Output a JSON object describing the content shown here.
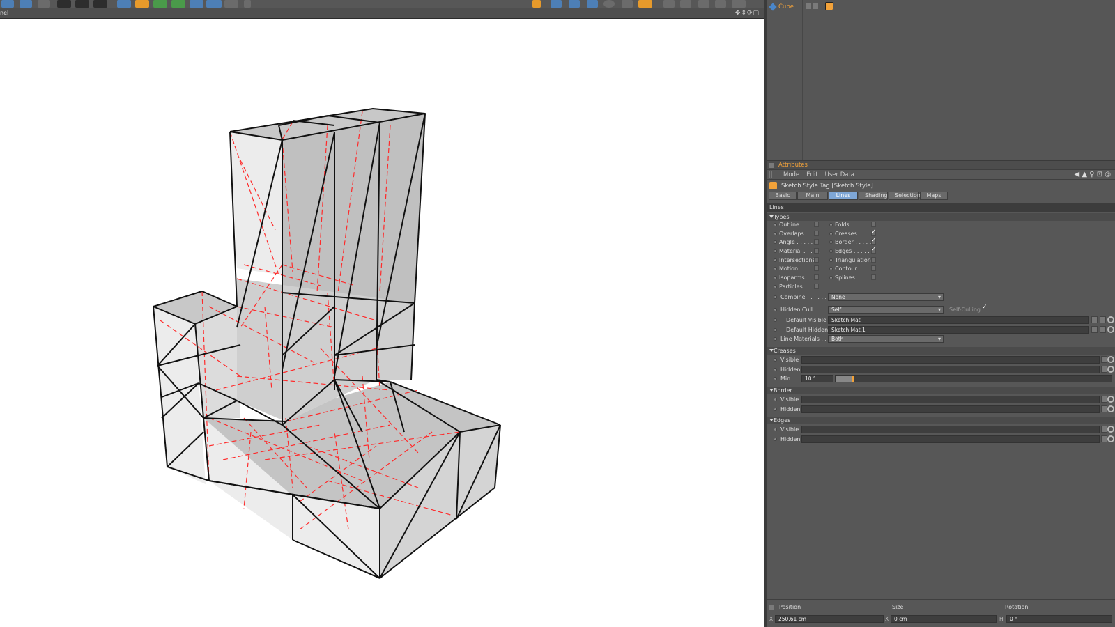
{
  "viewport": {
    "title": "nel",
    "nav_icons": "✥⇕⟳▢"
  },
  "object_manager": {
    "object_name": "Cube"
  },
  "attributes": {
    "title": "Attributes",
    "menu": [
      "Mode",
      "Edit",
      "User Data"
    ],
    "right_icons": "◀ ▲ ⚲ ⊡ ◎",
    "object_type": "Sketch Style Tag [Sketch Style]",
    "tabs": [
      "Basic",
      "Main",
      "Lines",
      "Shading",
      "Selections",
      "Maps"
    ],
    "active_tab": "Lines",
    "section": "Lines",
    "types_head": "Types",
    "types_left": [
      {
        "label": "Outline . . . . .",
        "checked": false
      },
      {
        "label": "Overlaps . . . .",
        "checked": false
      },
      {
        "label": "Angle . . . . . .",
        "checked": false
      },
      {
        "label": "Material . . . . .",
        "checked": false
      },
      {
        "label": "Intersections",
        "checked": false
      },
      {
        "label": "Motion . . . . .",
        "checked": false
      },
      {
        "label": "Isoparms . . . .",
        "checked": false
      },
      {
        "label": "Particles . . . .",
        "checked": false
      }
    ],
    "types_right": [
      {
        "label": "Folds . . . . . .",
        "checked": false
      },
      {
        "label": "Creases. . . . .",
        "checked": true
      },
      {
        "label": "Border . . . . .",
        "checked": true
      },
      {
        "label": "Edges . . . . . .",
        "checked": true
      },
      {
        "label": "Triangulation",
        "checked": false
      },
      {
        "label": "Contour . . . . .",
        "checked": false
      },
      {
        "label": "Splines . . . . .",
        "checked": false
      }
    ],
    "combine": {
      "label": "Combine . . . . . . .",
      "value": "None"
    },
    "hidden_cull": {
      "label": "Hidden Cull . . . .",
      "value": "Self",
      "self_culling_label": "Self-Culling"
    },
    "default_visible": {
      "label": "Default Visible",
      "value": "Sketch Mat"
    },
    "default_hidden": {
      "label": "Default Hidden",
      "value": "Sketch Mat.1"
    },
    "line_materials": {
      "label": "Line Materials . . .",
      "value": "Both"
    },
    "creases_head": "Creases",
    "creases": {
      "visible": "Visible",
      "hidden": "Hidden",
      "min_label": "Min. . .",
      "min_value": "10 °",
      "min_level": 0.06
    },
    "border_head": "Border",
    "border": {
      "visible": "Visible",
      "hidden": "Hidden"
    },
    "edges_head": "Edges",
    "edges": {
      "visible": "Visible",
      "hidden": "Hidden"
    }
  },
  "coordinates": {
    "headers": [
      "Position",
      "Size",
      "Rotation"
    ],
    "x_axis": "X",
    "h_axis": "H",
    "position_x": "250.61 cm",
    "size_x": "0 cm",
    "rotation_h": "0 °"
  },
  "colors": {
    "accent": "#f2a23a",
    "active_tab": "#7ea6d6",
    "hidden_lines": "#ff2a2a",
    "visible_lines": "#111111",
    "face_light": "#ececec",
    "face_mid": "#c8c8c8"
  }
}
